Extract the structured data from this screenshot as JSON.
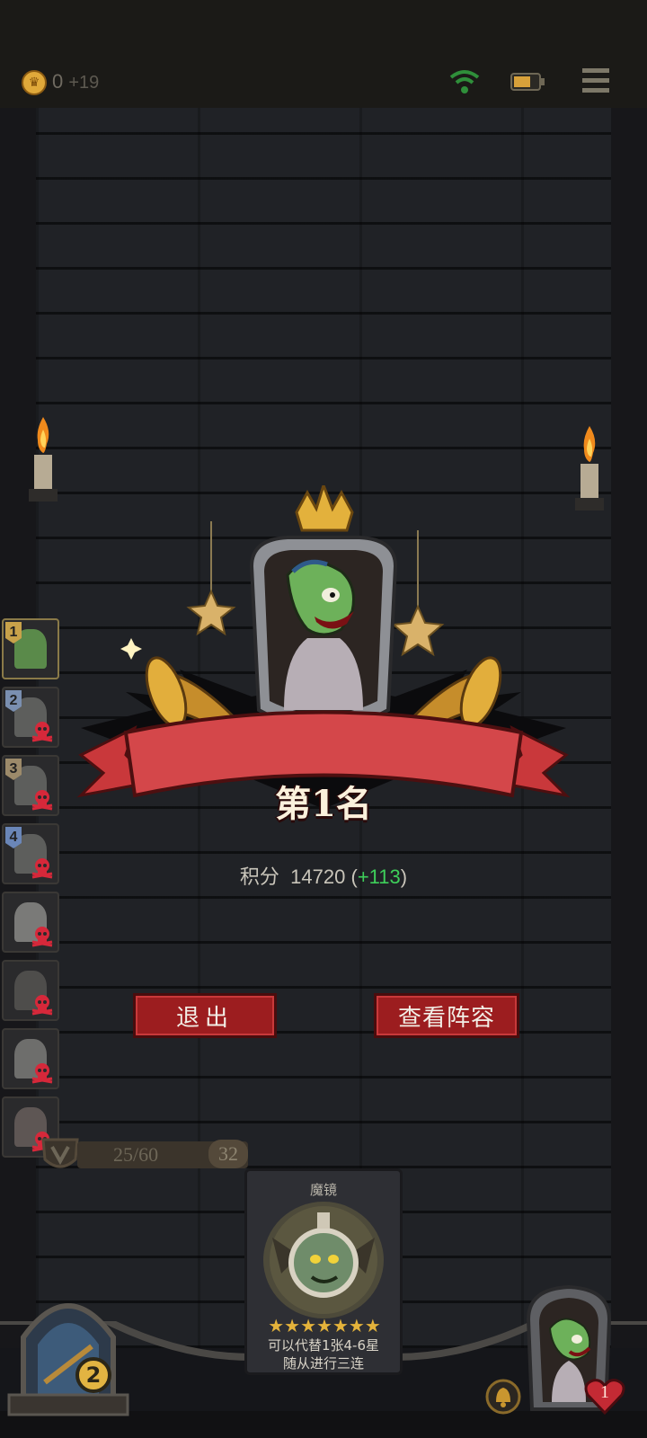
{
  "header": {
    "coins": "0",
    "coins_gain": "+19",
    "icons": [
      "coin-icon",
      "wifi-icon",
      "battery-icon",
      "menu-icon"
    ]
  },
  "result": {
    "rank_label": "第1名",
    "score_label": "积分",
    "score_value": "14720",
    "score_delta_open": "(",
    "score_delta": "+113",
    "score_delta_close": ")"
  },
  "buttons": {
    "exit": "退出",
    "view_lineup": "查看阵容"
  },
  "leaderboard": [
    {
      "rank": "1",
      "eliminated": false
    },
    {
      "rank": "2",
      "eliminated": true
    },
    {
      "rank": "3",
      "eliminated": true
    },
    {
      "rank": "4",
      "eliminated": true
    },
    {
      "rank": "",
      "eliminated": true
    },
    {
      "rank": "",
      "eliminated": true
    },
    {
      "rank": "",
      "eliminated": true
    },
    {
      "rank": "",
      "eliminated": true
    }
  ],
  "level": {
    "xp": "25/60",
    "gold": "32",
    "tavern_level": "2"
  },
  "card": {
    "name": "魔镜",
    "stars": "★★★★★★★",
    "desc_line1": "可以代替1张4-6星",
    "desc_line2": "随从进行三连"
  },
  "player": {
    "health": "1"
  },
  "colors": {
    "banner_red": "#c9383b",
    "button_red": "#9c1d1f",
    "gold": "#e2b442",
    "delta_green": "#3ecf5a"
  }
}
